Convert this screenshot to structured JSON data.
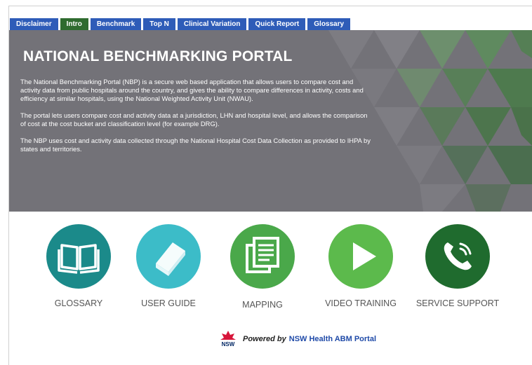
{
  "tabs": [
    {
      "label": "Disclaimer",
      "active": false
    },
    {
      "label": "Intro",
      "active": true
    },
    {
      "label": "Benchmark",
      "active": false
    },
    {
      "label": "Top N",
      "active": false
    },
    {
      "label": "Clinical Variation",
      "active": false
    },
    {
      "label": "Quick Report",
      "active": false
    },
    {
      "label": "Glossary",
      "active": false
    }
  ],
  "hero": {
    "title": "NATIONAL BENCHMARKING PORTAL",
    "paragraphs": [
      "The National Benchmarking Portal (NBP) is a secure web based application that allows users to compare cost and activity data from public hospitals around the country, and gives the ability to compare differences in activity, costs and efficiency at similar hospitals, using the National Weighted Activity Unit (NWAU).",
      "The portal lets users compare cost and activity data at a jurisdiction, LHN and hospital level, and allows the comparison of cost at the cost bucket and classification level (for example DRG).",
      "The NBP uses cost and activity data collected through the National Hospital Cost Data Collection as provided to IHPA by states and territories."
    ]
  },
  "tiles": [
    {
      "label": "GLOSSARY",
      "icon": "open-book-icon",
      "color": "#1b8a8a"
    },
    {
      "label": "USER GUIDE",
      "icon": "closed-book-icon",
      "color": "#3cbcc8"
    },
    {
      "label": "MAPPING",
      "icon": "documents-icon",
      "color": "#4aa84a"
    },
    {
      "label": "VIDEO TRAINING",
      "icon": "play-icon",
      "color": "#5cba4c"
    },
    {
      "label": "SERVICE SUPPORT",
      "icon": "phone-icon",
      "color": "#1f6b2e"
    }
  ],
  "footer": {
    "logo_text": "NSW",
    "powered_label": "Powered by",
    "portal_label": "NSW Health ABM Portal"
  }
}
